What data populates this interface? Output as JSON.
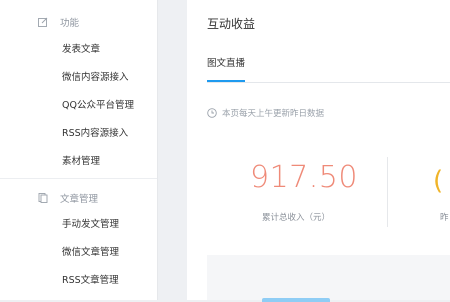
{
  "sidebar": {
    "sections": [
      {
        "title": "功能",
        "icon": "edit-icon",
        "items": [
          {
            "label": "发表文章"
          },
          {
            "label": "微信内容源接入"
          },
          {
            "label": "QQ公众平台管理"
          },
          {
            "label": "RSS内容源接入"
          },
          {
            "label": "素材管理"
          }
        ]
      },
      {
        "title": "文章管理",
        "icon": "document-icon",
        "items": [
          {
            "label": "手动发文管理"
          },
          {
            "label": "微信文章管理"
          },
          {
            "label": "RSS文章管理"
          }
        ]
      }
    ]
  },
  "main": {
    "title": "互动收益",
    "tabs": [
      {
        "label": "图文直播",
        "active": true
      }
    ],
    "notice": "本页每天上午更新昨日数据",
    "stats": [
      {
        "value": "917.50",
        "label": "累计总收入（元）",
        "color": "#ef8a78"
      },
      {
        "value": "(",
        "label": "昨",
        "color": "#f0b429"
      }
    ]
  },
  "colors": {
    "accent": "#1e9aef",
    "stat_primary": "#ef8a78",
    "stat_secondary": "#f0b429"
  }
}
